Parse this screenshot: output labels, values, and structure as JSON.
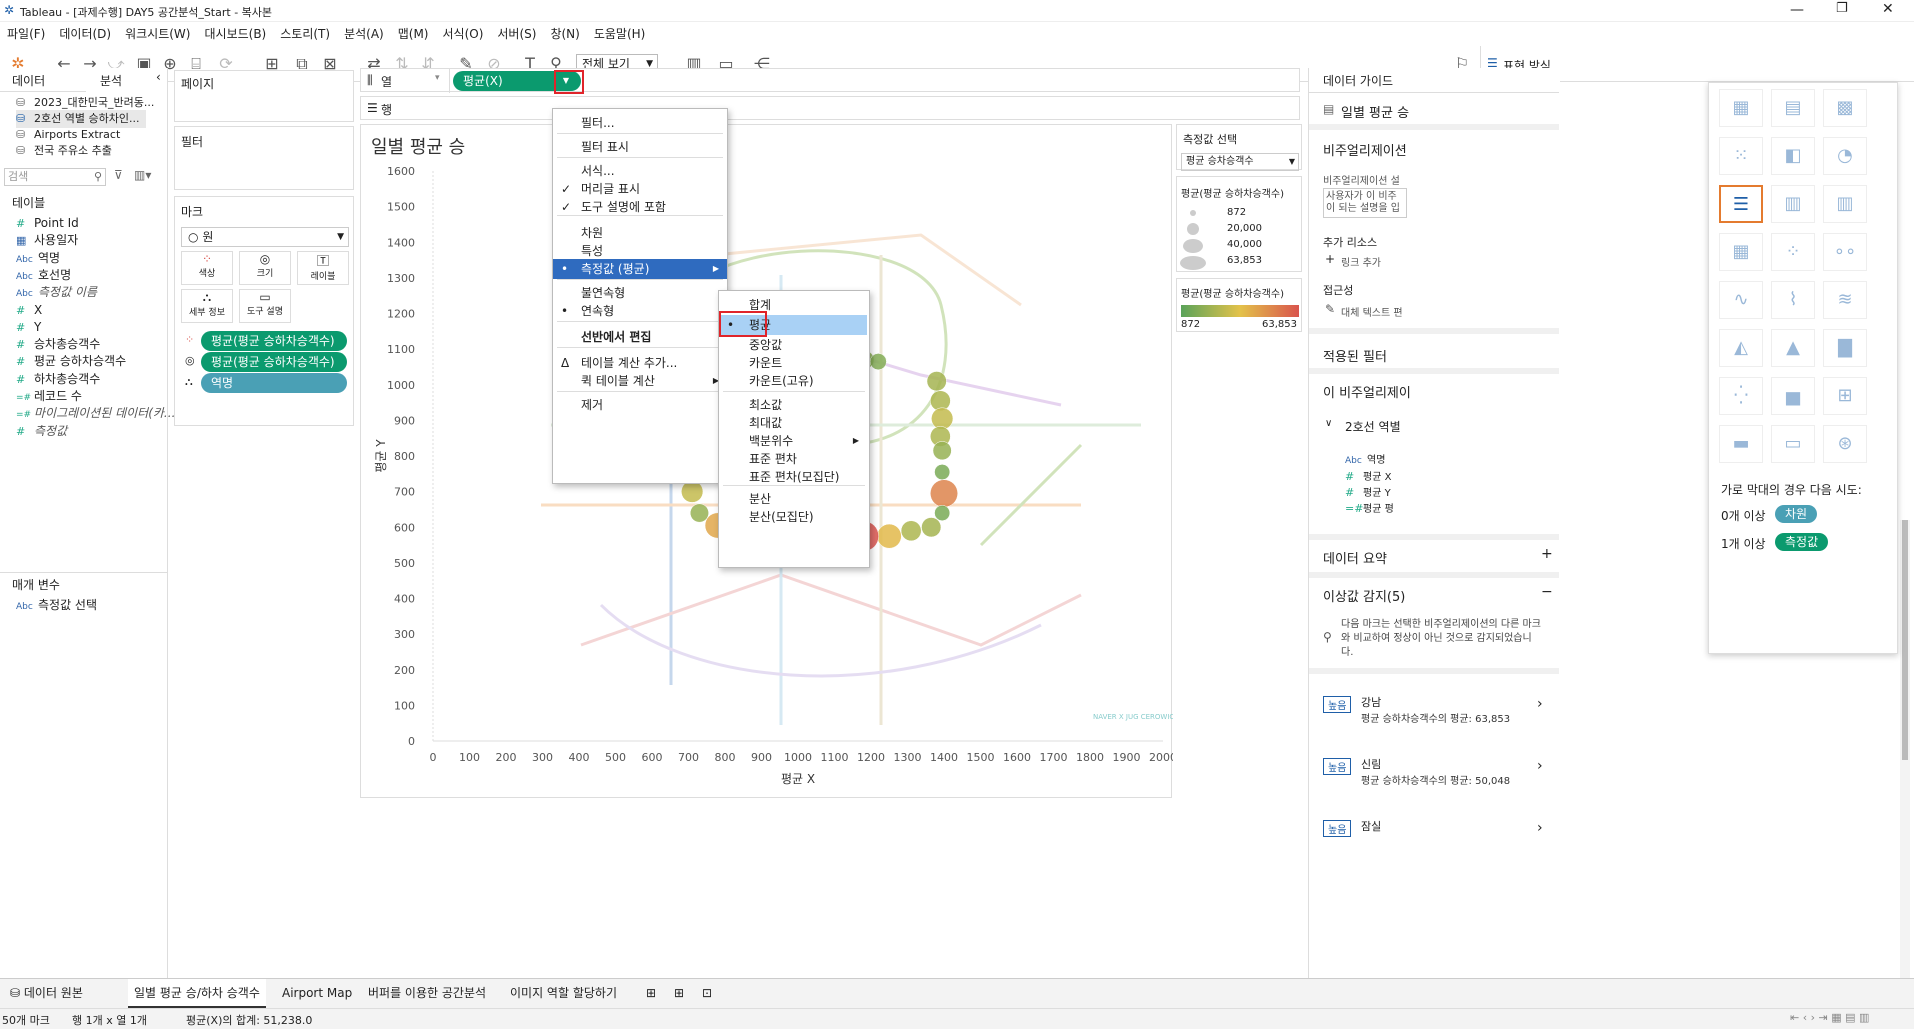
{
  "window": {
    "title": "Tableau - [과제수행] DAY5 공간분석_Start - 복사본"
  },
  "menubar": [
    "파일(F)",
    "데이터(D)",
    "워크시트(W)",
    "대시보드(B)",
    "스토리(T)",
    "분석(A)",
    "맵(M)",
    "서식(O)",
    "서버(S)",
    "창(N)",
    "도움말(H)"
  ],
  "toolbar": {
    "view_select": "전체 보기",
    "show_me": "표현 방식"
  },
  "data_pane": {
    "tabs": [
      "데이터",
      "분석"
    ],
    "sources": [
      "2023_대한민국_반려동...",
      "2호선 역별 승하차인...",
      "Airports Extract",
      "전국 주유소 추출"
    ],
    "search_placeholder": "검색",
    "tables_title": "테이블",
    "fields": [
      {
        "type": "#",
        "name": "Point Id"
      },
      {
        "type": "date",
        "name": "사용일자"
      },
      {
        "type": "Abc",
        "name": "역명"
      },
      {
        "type": "Abc",
        "name": "호선명"
      },
      {
        "type": "Abc",
        "name": "측정값 이름"
      },
      {
        "type": "#",
        "name": "X"
      },
      {
        "type": "#",
        "name": "Y"
      },
      {
        "type": "#",
        "name": "승차총승객수"
      },
      {
        "type": "#",
        "name": "평균 승하차승객수"
      },
      {
        "type": "#",
        "name": "하차총승객수"
      },
      {
        "type": "=#",
        "name": "레코드 수"
      },
      {
        "type": "=#",
        "name": "마이그레이션된 데이터(카..."
      },
      {
        "type": "#",
        "name": "측정값"
      }
    ],
    "params_title": "매개 변수",
    "params": [
      {
        "type": "Abc",
        "name": "측정값 선택"
      }
    ]
  },
  "shelves": {
    "pages": "페이지",
    "filters": "필터",
    "marks": "마크",
    "mark_type": "원",
    "mark_buttons": [
      "색상",
      "크기",
      "레이블",
      "세부 정보",
      "도구 설명"
    ],
    "mark_pills": [
      "평균(평균 승하차승객수)",
      "평균(평균 승하차승객수)",
      "역명"
    ],
    "columns_label": "열",
    "rows_label": "행",
    "columns_pill": "평균(X)"
  },
  "context_menu": {
    "items": [
      "필터...",
      "필터 표시",
      "서식...",
      "머리글 표시",
      "도구 설명에 포함",
      "차원",
      "특성",
      "측정값 (평균)",
      "불연속형",
      "연속형",
      "선반에서 편집",
      "테이블 계산 추가...",
      "퀵 테이블 계산",
      "제거"
    ]
  },
  "submenu": {
    "items": [
      "합계",
      "평균",
      "중앙값",
      "카운트",
      "카운트(고유)",
      "최소값",
      "최대값",
      "백분위수",
      "표준 편차",
      "표준 편차(모집단)",
      "분산",
      "분산(모집단)"
    ]
  },
  "chart": {
    "title": "일별 평균 승",
    "ylabel": "평균 Y",
    "xlabel": "평균 X",
    "watermark": "NAVER X JUG CEROWIC"
  },
  "chart_data": {
    "type": "scatter",
    "title": "일별 평균 승",
    "xlabel": "평균 X",
    "ylabel": "평균 Y",
    "xlim": [
      0,
      2000
    ],
    "ylim": [
      0,
      1600
    ],
    "xticks": [
      0,
      100,
      200,
      300,
      400,
      500,
      600,
      700,
      800,
      900,
      1000,
      1100,
      1200,
      1300,
      1400,
      1500,
      1600,
      1700,
      1800,
      1900,
      2000
    ],
    "yticks": [
      0,
      100,
      200,
      300,
      400,
      500,
      600,
      700,
      800,
      900,
      1000,
      1100,
      1200,
      1300,
      1400,
      1500,
      1600
    ],
    "size_range": [
      872,
      63853
    ],
    "points": [
      {
        "x": 660,
        "y": 1065,
        "v": 9000
      },
      {
        "x": 690,
        "y": 1090,
        "v": 12000
      },
      {
        "x": 760,
        "y": 1065,
        "v": 20000
      },
      {
        "x": 825,
        "y": 1065,
        "v": 15000
      },
      {
        "x": 870,
        "y": 1065,
        "v": 8000
      },
      {
        "x": 910,
        "y": 1065,
        "v": 12000
      },
      {
        "x": 960,
        "y": 1065,
        "v": 15000
      },
      {
        "x": 1010,
        "y": 1065,
        "v": 18000
      },
      {
        "x": 1050,
        "y": 1065,
        "v": 8000
      },
      {
        "x": 1090,
        "y": 1065,
        "v": 20000
      },
      {
        "x": 1140,
        "y": 1065,
        "v": 30000
      },
      {
        "x": 1185,
        "y": 1070,
        "v": 12000
      },
      {
        "x": 1220,
        "y": 1065,
        "v": 10000
      },
      {
        "x": 1380,
        "y": 1010,
        "v": 18000
      },
      {
        "x": 1390,
        "y": 955,
        "v": 20000
      },
      {
        "x": 1395,
        "y": 905,
        "v": 25000
      },
      {
        "x": 1390,
        "y": 855,
        "v": 20000
      },
      {
        "x": 1395,
        "y": 815,
        "v": 15000
      },
      {
        "x": 1395,
        "y": 755,
        "v": 8000
      },
      {
        "x": 1400,
        "y": 695,
        "v": 50048
      },
      {
        "x": 1395,
        "y": 640,
        "v": 8000
      },
      {
        "x": 1365,
        "y": 600,
        "v": 18000
      },
      {
        "x": 1310,
        "y": 590,
        "v": 20000
      },
      {
        "x": 1250,
        "y": 575,
        "v": 35000
      },
      {
        "x": 1180,
        "y": 575,
        "v": 63853
      },
      {
        "x": 1130,
        "y": 580,
        "v": 25000
      },
      {
        "x": 1080,
        "y": 580,
        "v": 15000
      },
      {
        "x": 1030,
        "y": 580,
        "v": 25000
      },
      {
        "x": 980,
        "y": 580,
        "v": 30000
      },
      {
        "x": 930,
        "y": 575,
        "v": 15000
      },
      {
        "x": 880,
        "y": 575,
        "v": 40000
      },
      {
        "x": 830,
        "y": 580,
        "v": 30000
      },
      {
        "x": 780,
        "y": 605,
        "v": 40000
      },
      {
        "x": 730,
        "y": 640,
        "v": 15000
      },
      {
        "x": 710,
        "y": 700,
        "v": 25000
      },
      {
        "x": 715,
        "y": 750,
        "v": 12000
      },
      {
        "x": 685,
        "y": 800,
        "v": 10000
      }
    ]
  },
  "legends": {
    "param_title": "측정값 선택",
    "param_value": "평균 승차승객수",
    "size_title": "평균(평균 승하차승객수)",
    "size_items": [
      "872",
      "20,000",
      "40,000",
      "63,853"
    ],
    "color_title": "평균(평균 승하차승객수)",
    "color_min": "872",
    "color_max": "63,853",
    "color_scale": [
      "#d9544d",
      "#e3b84a",
      "#5aa35a"
    ]
  },
  "data_guide": {
    "title": "데이터 가이드",
    "sheet_name": "일별 평균 승",
    "viz_title": "비주얼리제이션",
    "viz_desc_label": "비주얼리제이션 설",
    "viz_desc_placeholder": "사용자가 이 비주 이 되는 설명을 입",
    "resources": "추가 리소스",
    "add_link": "링크 추가",
    "access": "접근성",
    "alt_text": "대체 텍스트 편",
    "applied_filters": "적용된 필터",
    "this_viz": "이 비주얼리제이",
    "ds_name": "2호선 역별",
    "ds_fields": [
      "역명",
      "평균 X",
      "평균 Y",
      "평균 평"
    ],
    "data_summary": "데이터 요약",
    "outliers": "이상값 감지(5)",
    "outlier_desc": "다음 마크는 선택한 비주얼리제이션의 다른 마크와 비교하여 정상이 아닌 것으로 감지되었습니다.",
    "outlier_items": [
      {
        "badge": "높음",
        "name": "강남",
        "detail": "평균 승하차승객수의 평균: 63,853"
      },
      {
        "badge": "높음",
        "name": "신림",
        "detail": "평균 승하차승객수의 평균: 50,048"
      },
      {
        "badge": "높음",
        "name": "잠실",
        "detail": ""
      }
    ]
  },
  "show_me": {
    "hint": "가로 막대의 경우 다음 시도:",
    "req1": "0개 이상",
    "chip1": "차원",
    "req2": "1개 이상",
    "chip2": "측정값"
  },
  "sheet_tabs": [
    "데이터 원본",
    "일별 평균 승/하차 승객수",
    "Airport Map",
    "버퍼를 이용한 공간분석",
    "이미지 역할 할당하기"
  ],
  "status": {
    "marks": "50개 마크",
    "rows": "행 1개 x 열 1개",
    "sum": "평균(X)의 합계: 51,238.0"
  }
}
